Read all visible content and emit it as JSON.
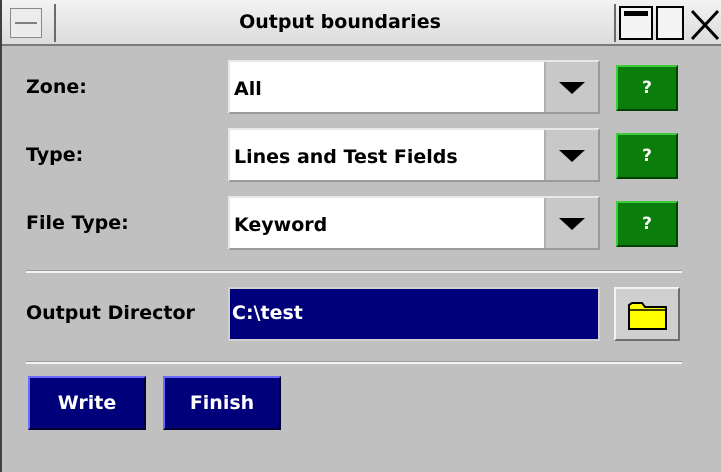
{
  "window": {
    "title": "Output boundaries"
  },
  "form": {
    "zone": {
      "label": "Zone:",
      "value": "All",
      "help_label": "?"
    },
    "type": {
      "label": "Type:",
      "value": "Lines and Test Fields",
      "help_label": "?"
    },
    "file_type": {
      "label": "File Type:",
      "value": "Keyword",
      "help_label": "?"
    },
    "output_directory": {
      "label": "Output Director",
      "value": "C:\\test"
    }
  },
  "actions": {
    "write_label": "Write",
    "finish_label": "Finish"
  },
  "colors": {
    "background": "#c0c0c0",
    "help_button": "#0a7d0a",
    "action_button": "#00007b",
    "folder_icon": "#ffff00"
  },
  "icons": {
    "dropdown": "triangle-down",
    "folder": "folder",
    "close": "x",
    "minimize": "bar",
    "maximize": "square",
    "system_menu": "dash"
  }
}
